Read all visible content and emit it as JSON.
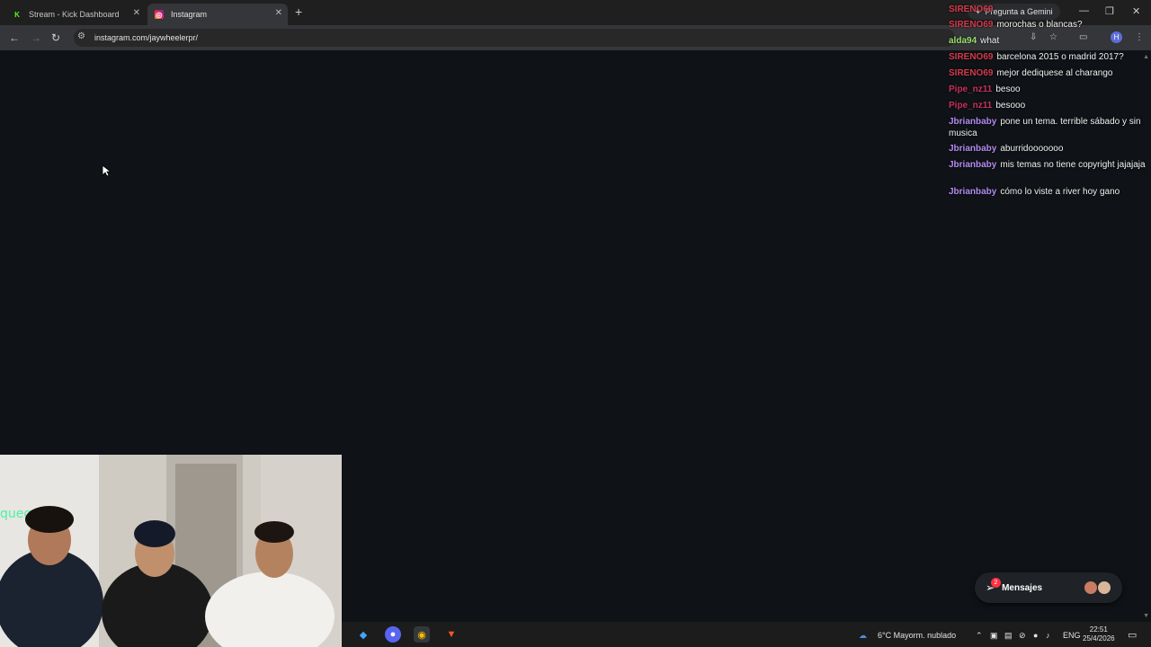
{
  "browser": {
    "tabs": [
      {
        "label": "Stream - Kick Dashboard",
        "icon": "kick-icon"
      },
      {
        "label": "Instagram",
        "icon": "instagram-icon",
        "active": true
      }
    ],
    "url": "instagram.com/jaywheelerpr/",
    "gemini_label": "Pregunta a Gemini",
    "profile_initial": "H"
  },
  "chat": {
    "messages": [
      {
        "user": "SIRENO69",
        "text": "",
        "color": "#d43b4c"
      },
      {
        "user": "SIRENO69",
        "text": "morochas o blancas?",
        "color": "#d43b4c"
      },
      {
        "user": "alda94",
        "text": "what",
        "color": "#9be06a"
      },
      {
        "user": "SIRENO69",
        "text": "barcelona 2015 o madrid 2017?",
        "color": "#d43b4c"
      },
      {
        "user": "SIRENO69",
        "text": "mejor dediquese al charango",
        "color": "#d43b4c"
      },
      {
        "user": "Pipe_nz11",
        "text": "besoo",
        "color": "#c9305a"
      },
      {
        "user": "Pipe_nz11",
        "text": "besooo",
        "color": "#c9305a"
      },
      {
        "user": "Jbrianbaby",
        "text": "pone un tema. terrible sábado y sin musica",
        "color": "#b38bf0"
      },
      {
        "user": "Jbrianbaby",
        "text": "aburridooooooo",
        "color": "#b38bf0"
      },
      {
        "user": "Jbrianbaby",
        "text": "mis temas no tiene copyright jajajaja",
        "color": "#b38bf0"
      },
      {
        "user": "Jbrianbaby",
        "text": "cómo lo viste a river hoy gano",
        "color": "#b38bf0"
      }
    ]
  },
  "messages_pill": {
    "label": "Mensajes",
    "count": "2"
  },
  "taskbar": {
    "weather": "6°C  Mayorm. nublado",
    "language": "ENG",
    "time": "22:51",
    "date": "25/4/2026"
  }
}
